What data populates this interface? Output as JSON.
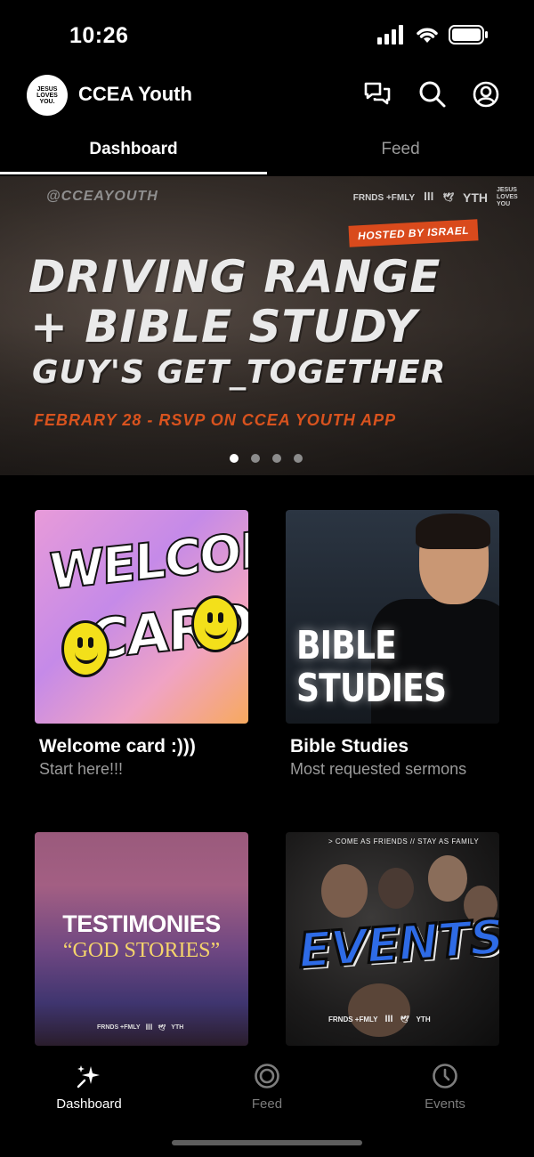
{
  "status_bar": {
    "time": "10:26"
  },
  "header": {
    "logo_text": [
      "JESUS",
      "LOVES",
      "YOU."
    ],
    "title": "CCEA Youth",
    "icons": [
      "chat-icon",
      "search-icon",
      "profile-icon"
    ]
  },
  "tabs": [
    {
      "label": "Dashboard",
      "active": true
    },
    {
      "label": "Feed",
      "active": false
    }
  ],
  "banner": {
    "handle": "@CCEAYOUTH",
    "brands": [
      "FRNDS +FMLY",
      "ꟾꟾꟾ",
      "🕊",
      "YTH",
      "JESUS LOVES YOU"
    ],
    "hosted": "HOSTED BY ISRAEL",
    "line1": "DRIVING RANGE",
    "line2": "+ BIBLE STUDY",
    "line3": "GUY'S GET_TOGETHER",
    "rsvp": "FEBRARY 28 - RSVP ON CCEA YOUTH APP",
    "slide_count": 4,
    "active_slide": 1
  },
  "cards": [
    {
      "title": "Welcome card :)))",
      "subtitle": "Start here!!!",
      "art_text": [
        "WELCOME",
        "CARD"
      ]
    },
    {
      "title": "Bible Studies",
      "subtitle": "Most requested sermons",
      "art_text": [
        "BIBLE",
        "STUDIES"
      ]
    },
    {
      "title": "",
      "subtitle": "",
      "art_text": [
        "TESTIMONIES",
        "“GOD STORIES”"
      ]
    },
    {
      "title": "",
      "subtitle": "",
      "art_text": [
        "> COME AS FRIENDS // STAY AS FAMILY",
        "EVENTS"
      ]
    }
  ],
  "bottom_nav": [
    {
      "label": "Dashboard",
      "icon": "sparkle-icon",
      "active": true
    },
    {
      "label": "Feed",
      "icon": "target-icon",
      "active": false
    },
    {
      "label": "Events",
      "icon": "clock-icon",
      "active": false
    }
  ],
  "colors": {
    "accent_orange": "#d94a1c",
    "background": "#000000",
    "inactive_text": "#9a9a9a"
  }
}
